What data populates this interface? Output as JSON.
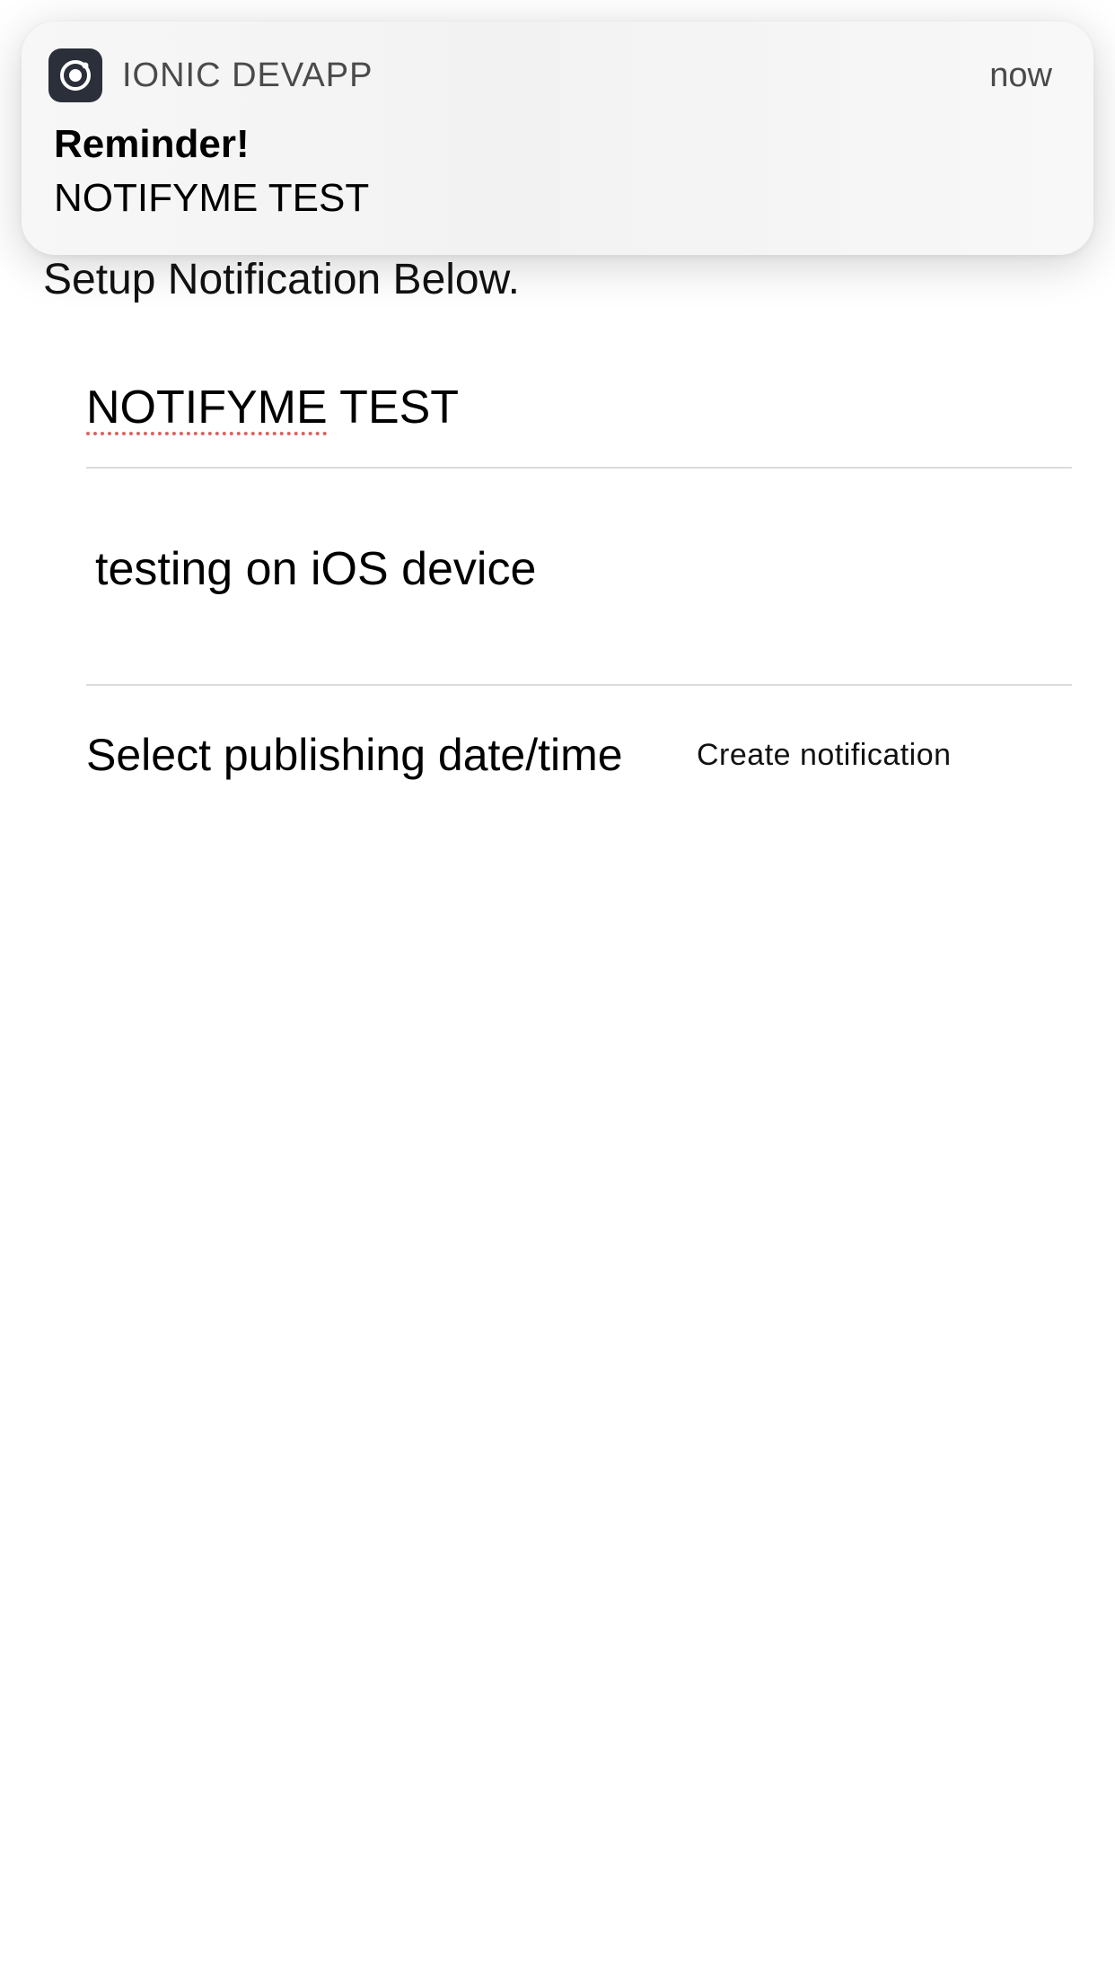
{
  "notification": {
    "app_name": "IONIC DEVAPP",
    "time": "now",
    "title": "Reminder!",
    "body": "NOTIFYME TEST"
  },
  "page": {
    "heading": "Setup Notification Below."
  },
  "form": {
    "title_field": {
      "value_part1": "NOTIFYME",
      "value_part2": " TEST"
    },
    "message_field": {
      "value": "testing on iOS device"
    },
    "date_label": "Select publishing date/time",
    "create_button": "Create notification"
  }
}
